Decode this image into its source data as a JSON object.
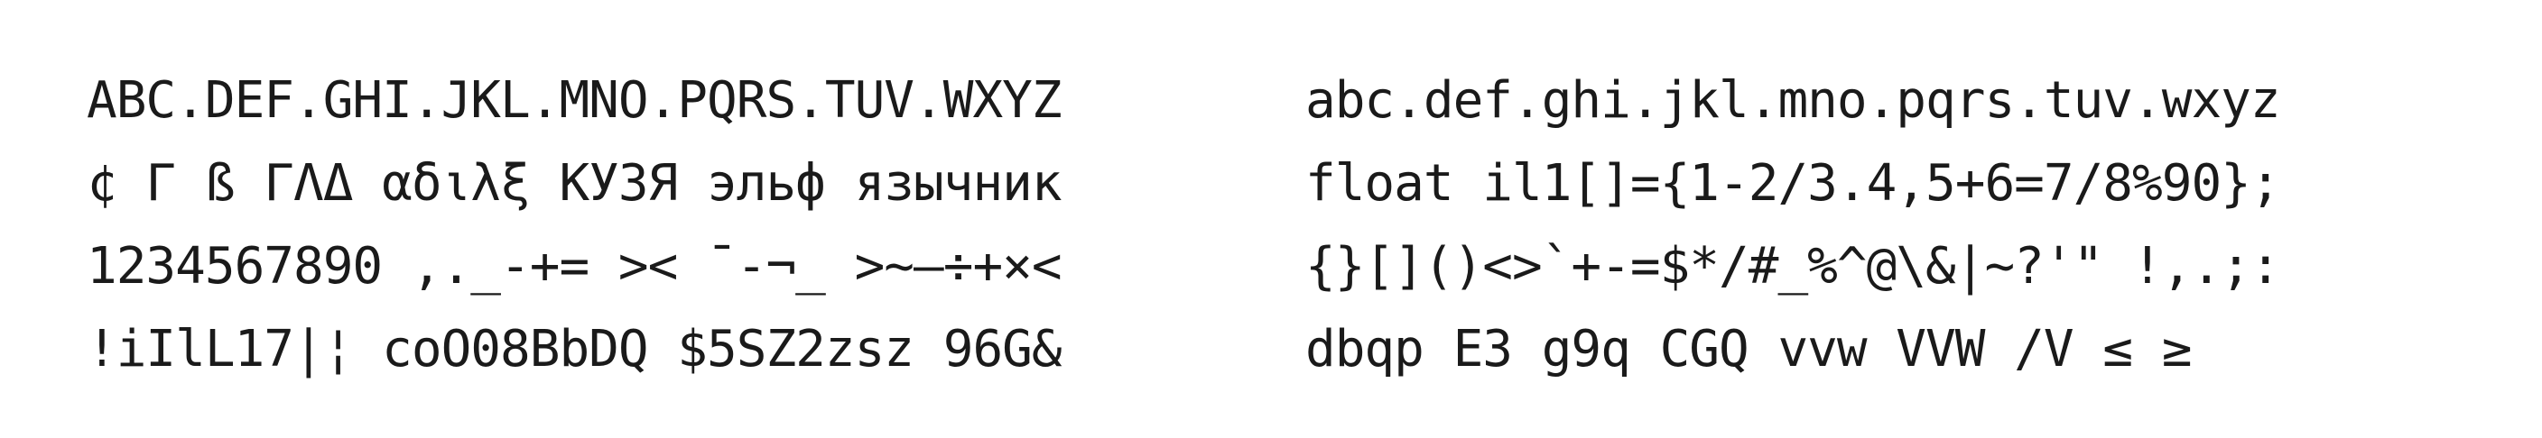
{
  "specimen": {
    "left_lines": [
      "ABC.DEF.GHI.JKL.MNO.PQRS.TUV.WXYZ",
      "¢ Γ ß ΓΛΔ αδιλξ КУЗЯ эльф язычник",
      "1234567890 ,._-+= >< ¯-¬_ >~–÷+×<",
      "!iIlL17|¦ coO08BbDQ $5SZ2zsz 96G&"
    ],
    "right_lines": [
      "abc.def.ghi.jkl.mno.pqrs.tuv.wxyz",
      "float il1[]={1-2/3.4,5+6=7/8%90};",
      "{}[]()<>`+-=$*/#_%^@\\&|~?'\" !,.;:",
      "dbqp E3 g9q CGQ vvw VVW /V ≤ ≥"
    ]
  }
}
